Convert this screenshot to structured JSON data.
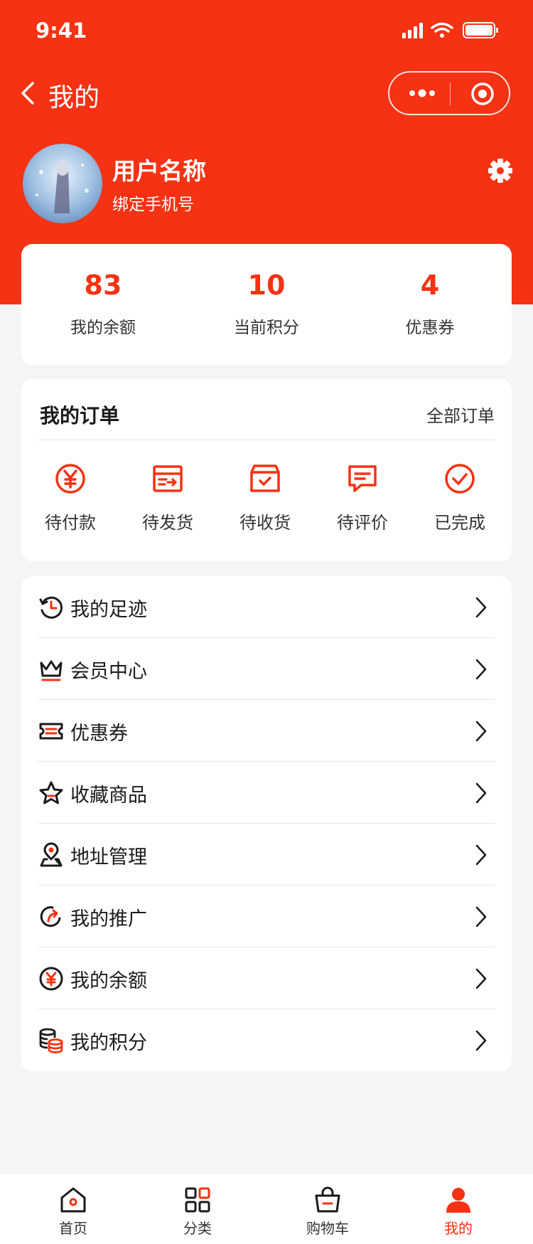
{
  "status_bar": {
    "time": "9:41"
  },
  "navbar": {
    "title": "我的"
  },
  "profile": {
    "username": "用户名称",
    "bind_phone": "绑定手机号"
  },
  "stats": [
    {
      "value": "83",
      "label": "我的余额"
    },
    {
      "value": "10",
      "label": "当前积分"
    },
    {
      "value": "4",
      "label": "优惠券"
    }
  ],
  "orders": {
    "title": "我的订单",
    "all_label": "全部订单",
    "items": [
      {
        "label": "待付款",
        "icon": "yen-circle-icon"
      },
      {
        "label": "待发货",
        "icon": "shipping-box-icon"
      },
      {
        "label": "待收货",
        "icon": "receive-box-icon"
      },
      {
        "label": "待评价",
        "icon": "comment-icon"
      },
      {
        "label": "已完成",
        "icon": "check-circle-icon"
      }
    ]
  },
  "menu": [
    {
      "label": "我的足迹",
      "icon": "history-icon"
    },
    {
      "label": "会员中心",
      "icon": "crown-icon"
    },
    {
      "label": "优惠券",
      "icon": "ticket-icon"
    },
    {
      "label": "收藏商品",
      "icon": "star-icon"
    },
    {
      "label": "地址管理",
      "icon": "location-icon"
    },
    {
      "label": "我的推广",
      "icon": "share-icon"
    },
    {
      "label": "我的余额",
      "icon": "yen-icon"
    },
    {
      "label": "我的积分",
      "icon": "coins-icon"
    }
  ],
  "tabbar": [
    {
      "label": "首页",
      "icon": "home-icon"
    },
    {
      "label": "分类",
      "icon": "category-icon"
    },
    {
      "label": "购物车",
      "icon": "cart-icon"
    },
    {
      "label": "我的",
      "icon": "user-icon",
      "active": true
    }
  ],
  "colors": {
    "brand": "#f53213",
    "background": "#f5f5f5"
  }
}
